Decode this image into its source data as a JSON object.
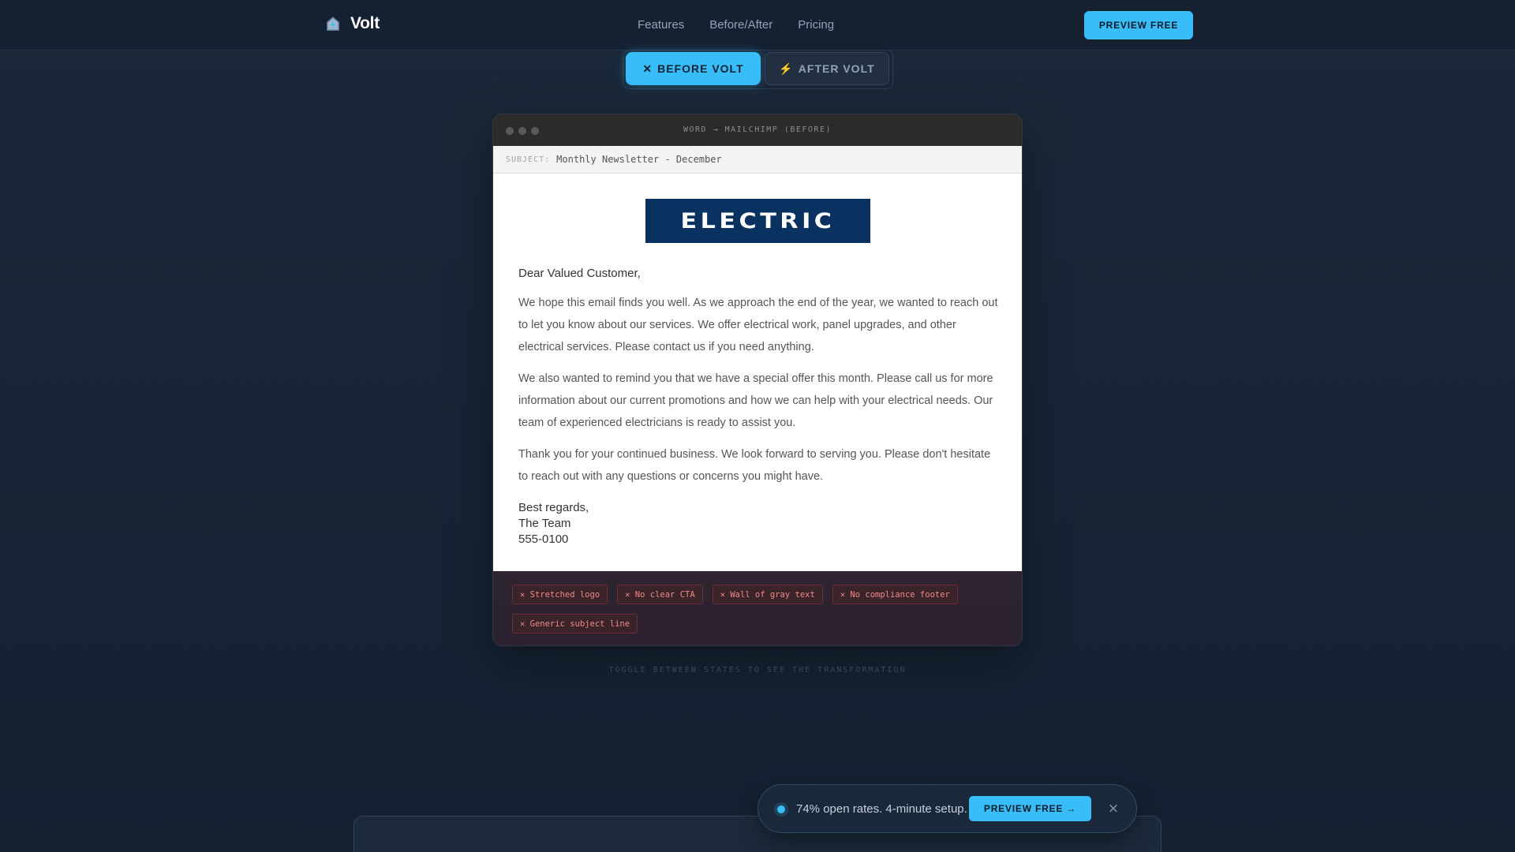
{
  "nav": {
    "brand": "Volt",
    "links": [
      "Features",
      "Before/After",
      "Pricing"
    ],
    "cta": "PREVIEW FREE"
  },
  "toggle": {
    "before_icon": "✕",
    "before_label": "BEFORE VOLT",
    "after_icon": "⚡",
    "after_label": "AFTER VOLT",
    "active": "before"
  },
  "window": {
    "title": "WORD → MAILCHIMP (BEFORE)",
    "subject_label": "SUBJECT:",
    "subject_value": "Monthly Newsletter - December"
  },
  "email": {
    "logo_text": "ELECTRIC",
    "greeting": "Dear Valued Customer,",
    "paragraphs": [
      "We hope this email finds you well. As we approach the end of the year, we wanted to reach out to let you know about our services. We offer electrical work, panel upgrades, and other electrical services. Please contact us if you need anything.",
      "We also wanted to remind you that we have a special offer this month. Please call us for more information about our current promotions and how we can help with your electrical needs. Our team of experienced electricians is ready to assist you.",
      "Thank you for your continued business. We look forward to serving you. Please don't hesitate to reach out with any questions or concerns you might have."
    ],
    "signoff": [
      "Best regards,",
      "The Team",
      "555-0100"
    ]
  },
  "issues": [
    "✕ Stretched logo",
    "✕ No clear CTA",
    "✕ Wall of gray text",
    "✕ No compliance footer",
    "✕ Generic subject line"
  ],
  "hint": "TOGGLE BETWEEN STATES TO SEE THE TRANSFORMATION",
  "float_bar": {
    "text": "74% open rates. 4-minute setup.",
    "cta": "PREVIEW FREE →",
    "close": "×"
  },
  "colors": {
    "accent": "#38bdf8",
    "background": "#1b2838",
    "logo_bg": "#0a3260",
    "issue_text": "#f08a8a"
  },
  "icons": {
    "brand": "house-bolt-icon",
    "window_controls": "traffic-light-dots"
  }
}
